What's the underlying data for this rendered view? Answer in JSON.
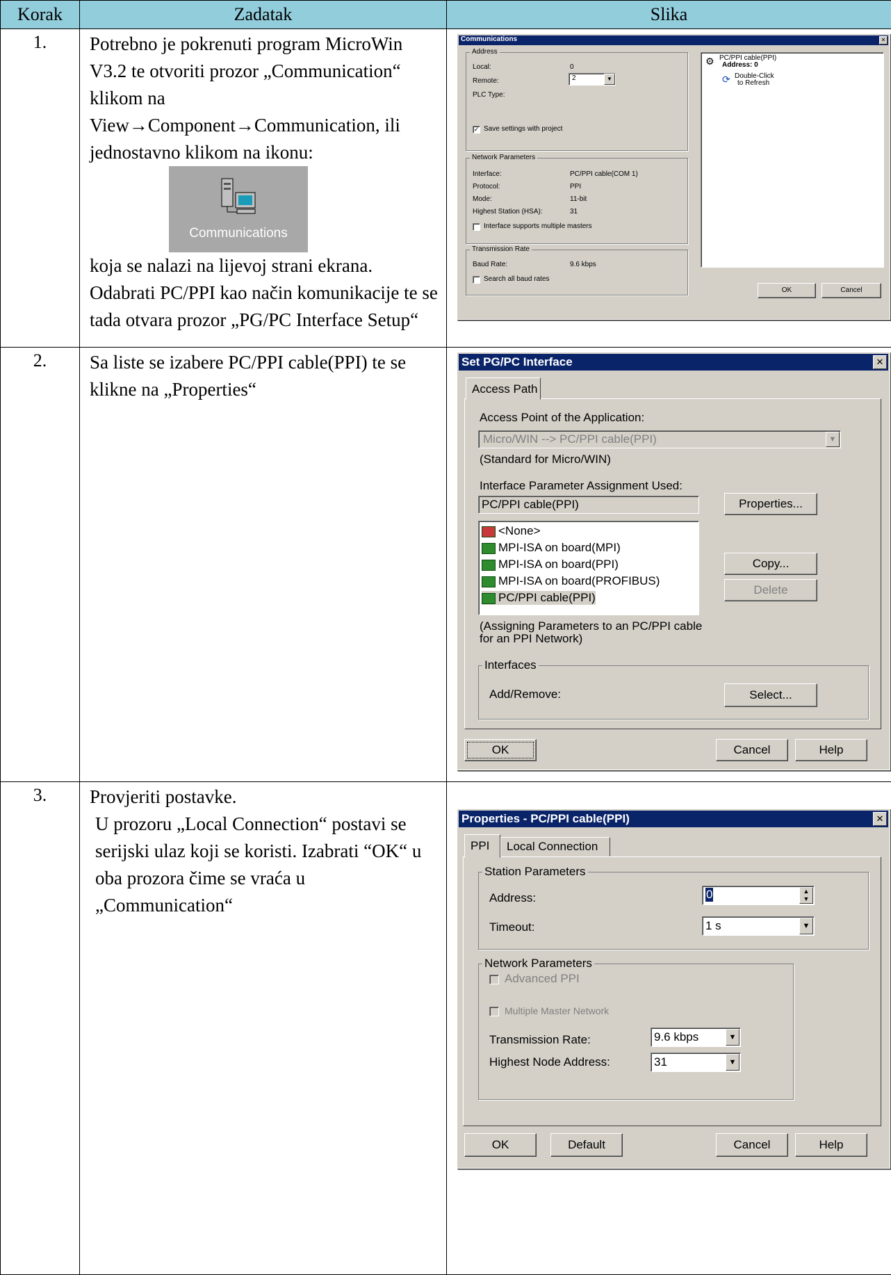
{
  "table": {
    "headers": [
      "Korak",
      "Zadatak",
      "Slika"
    ],
    "rows": [
      {
        "num": "1.",
        "text_a": "Potrebno je pokrenuti program MicroWin V3.2 te otvoriti prozor „Communication“ klikom na View→Component→Communication, ili jednostavno klikom na ikonu:",
        "icon_label": "Communications",
        "text_b": "koja se nalazi na lijevoj strani ekrana. Odabrati PC/PPI kao način komunikacije te se tada otvara prozor „PG/PC Interface Setup“"
      },
      {
        "num": "2.",
        "text": "Sa liste se izabere PC/PPI cable(PPI) te se klikne na „Properties“"
      },
      {
        "num": "3.",
        "line1": "Provjeriti postavke.",
        "line2": "U prozoru „Local Connection“ postavi se serijski ulaz koji se koristi. Izabrati “OK“ u oba prozora čime se vraća u „Communication“"
      }
    ]
  },
  "win1": {
    "title": "Communications",
    "close": "✕",
    "address_group": "Address",
    "local_label": "Local:",
    "local_value": "0",
    "remote_label": "Remote:",
    "remote_value": "2",
    "plc_type_label": "PLC Type:",
    "save_settings": "Save settings with project",
    "netparams_group": "Network Parameters",
    "interface_label": "Interface:",
    "interface_value": "PC/PPI cable(COM 1)",
    "protocol_label": "Protocol:",
    "protocol_value": "PPI",
    "mode_label": "Mode:",
    "mode_value": "11-bit",
    "hsa_label": "Highest Station (HSA):",
    "hsa_value": "31",
    "multi_masters": "Interface supports multiple masters",
    "transmission_group": "Transmission Rate",
    "baud_label": "Baud Rate:",
    "baud_value": "9.6 kbps",
    "search_baud": "Search all baud rates",
    "tree_cable": "PC/PPI cable(PPI)",
    "tree_address": "Address: 0",
    "tree_refresh_1": "Double-Click",
    "tree_refresh_2": "to Refresh",
    "ok": "OK",
    "cancel": "Cancel"
  },
  "win2": {
    "title": "Set PG/PC Interface",
    "close": "✕",
    "tab": "Access Path",
    "access_point_label": "Access Point of the Application:",
    "access_point_value": "Micro/WIN     --> PC/PPI cable(PPI)",
    "standard_note": "(Standard for Micro/WIN)",
    "param_label": "Interface Parameter Assignment Used:",
    "param_value": "PC/PPI cable(PPI)",
    "properties_btn": "Properties...",
    "list": [
      "<None>",
      "MPI-ISA on board(MPI)",
      "MPI-ISA on board(PPI)",
      "MPI-ISA on board(PROFIBUS)",
      "PC/PPI cable(PPI)"
    ],
    "copy_btn": "Copy...",
    "delete_btn": "Delete",
    "assign_note_1": "(Assigning Parameters to an PC/PPI cable",
    "assign_note_2": "for an PPI Network)",
    "interfaces_group": "Interfaces",
    "add_remove_label": "Add/Remove:",
    "select_btn": "Select...",
    "ok": "OK",
    "cancel": "Cancel",
    "help": "Help"
  },
  "win3": {
    "title": "Properties - PC/PPI cable(PPI)",
    "close": "✕",
    "tab_ppi": "PPI",
    "tab_local": "Local Connection",
    "station_group": "Station Parameters",
    "address_label": "Address:",
    "address_value": "0",
    "timeout_label": "Timeout:",
    "timeout_value": "1 s",
    "netparams_group": "Network Parameters",
    "advanced_ppi": "Advanced PPI",
    "multi_master": "Multiple Master Network",
    "trans_rate_label": "Transmission Rate:",
    "trans_rate_value": "9.6 kbps",
    "highest_node_label": "Highest Node Address:",
    "highest_node_value": "31",
    "ok": "OK",
    "default": "Default",
    "cancel": "Cancel",
    "help": "Help"
  }
}
